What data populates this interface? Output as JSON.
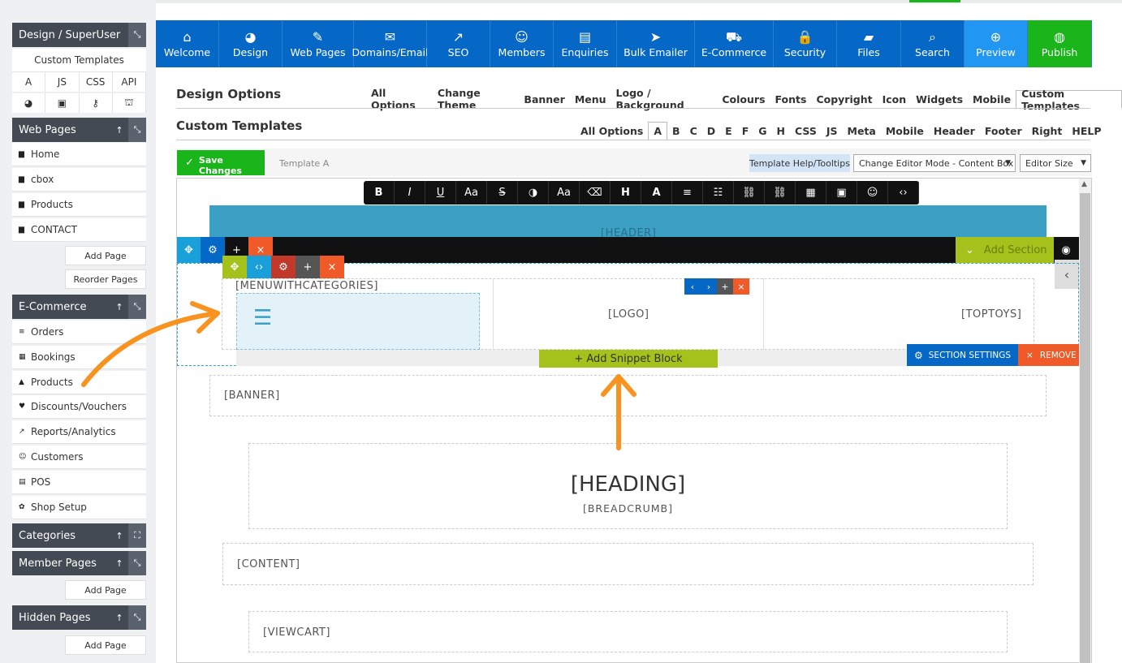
{
  "sidebar": {
    "design_title": "Design / SuperUser",
    "custom_templates": "Custom Templates",
    "lang_tabs": [
      "A",
      "JS",
      "CSS",
      "API"
    ],
    "web_pages": {
      "title": "Web Pages",
      "items": [
        "Home",
        "cbox",
        "Products",
        "CONTACT"
      ],
      "add": "Add Page",
      "reorder": "Reorder Pages"
    },
    "ecommerce": {
      "title": "E-Commerce",
      "items": [
        "Orders",
        "Bookings",
        "Products",
        "Discounts/Vouchers",
        "Reports/Analytics",
        "Customers",
        "POS",
        "Shop Setup"
      ]
    },
    "categories": "Categories",
    "member_pages": {
      "title": "Member Pages",
      "add": "Add Page"
    },
    "hidden_pages": {
      "title": "Hidden Pages",
      "add": "Add Page"
    }
  },
  "nav": [
    {
      "label": "Welcome",
      "icon": "home-icon",
      "glyph": "⌂"
    },
    {
      "label": "Design",
      "icon": "palette-icon",
      "glyph": "◕"
    },
    {
      "label": "Web Pages",
      "icon": "pencil-icon",
      "glyph": "✎"
    },
    {
      "label": "Domains/Email",
      "icon": "envelope-icon",
      "glyph": "✉"
    },
    {
      "label": "SEO",
      "icon": "trend-icon",
      "glyph": "↗"
    },
    {
      "label": "Members",
      "icon": "people-icon",
      "glyph": "☺"
    },
    {
      "label": "Enquiries",
      "icon": "chat-icon",
      "glyph": "▤"
    },
    {
      "label": "Bulk Emailer",
      "icon": "send-icon",
      "glyph": "➤"
    },
    {
      "label": "E-Commerce",
      "icon": "cart-icon",
      "glyph": "⛟"
    },
    {
      "label": "Security",
      "icon": "lock-icon",
      "glyph": "🔒"
    },
    {
      "label": "Files",
      "icon": "folder-icon",
      "glyph": "▰"
    },
    {
      "label": "Search",
      "icon": "search-icon",
      "glyph": "⌕"
    },
    {
      "label": "Preview",
      "icon": "zoom-icon",
      "glyph": "⊕"
    },
    {
      "label": "Publish",
      "icon": "globe-icon",
      "glyph": "◍"
    }
  ],
  "design_options": {
    "title": "Design Options",
    "tabs": [
      "All Options",
      "Change Theme",
      "Banner",
      "Menu",
      "Logo / Background",
      "Colours",
      "Fonts",
      "Copyright",
      "Icon",
      "Widgets",
      "Mobile",
      "Custom Templates"
    ]
  },
  "custom_templates": {
    "title": "Custom Templates",
    "tabs": [
      "All Options",
      "A",
      "B",
      "C",
      "D",
      "E",
      "F",
      "G",
      "H",
      "CSS",
      "JS",
      "Meta",
      "Mobile",
      "Header",
      "Footer",
      "Right",
      "HELP"
    ]
  },
  "toolbar": {
    "save": "Save Changes",
    "template_label": "Template A",
    "help": "Template Help/Tooltips",
    "editor_mode": "Change Editor Mode - Content Box",
    "editor_size": "Editor Size"
  },
  "editor": {
    "header": "[HEADER]",
    "add_section": "Add Section",
    "menu": "[MENUWITHCATEGORIES]",
    "logo": "[LOGO]",
    "toptoys": "[TOPTOYS]",
    "add_snippet": "+ Add Snippet Block",
    "section_settings": "SECTION SETTINGS",
    "remove": "REMOVE",
    "banner": "[BANNER]",
    "heading": "[HEADING]",
    "breadcrumb": "[BREADCRUMB]",
    "content": "[CONTENT]",
    "viewcart": "[VIEWCART]"
  },
  "colors": {
    "nav_blue": "#0568c6",
    "preview": "#2196f3",
    "publish": "#19b51a",
    "accent_green": "#a4c21b",
    "orange": "#f7931e"
  }
}
